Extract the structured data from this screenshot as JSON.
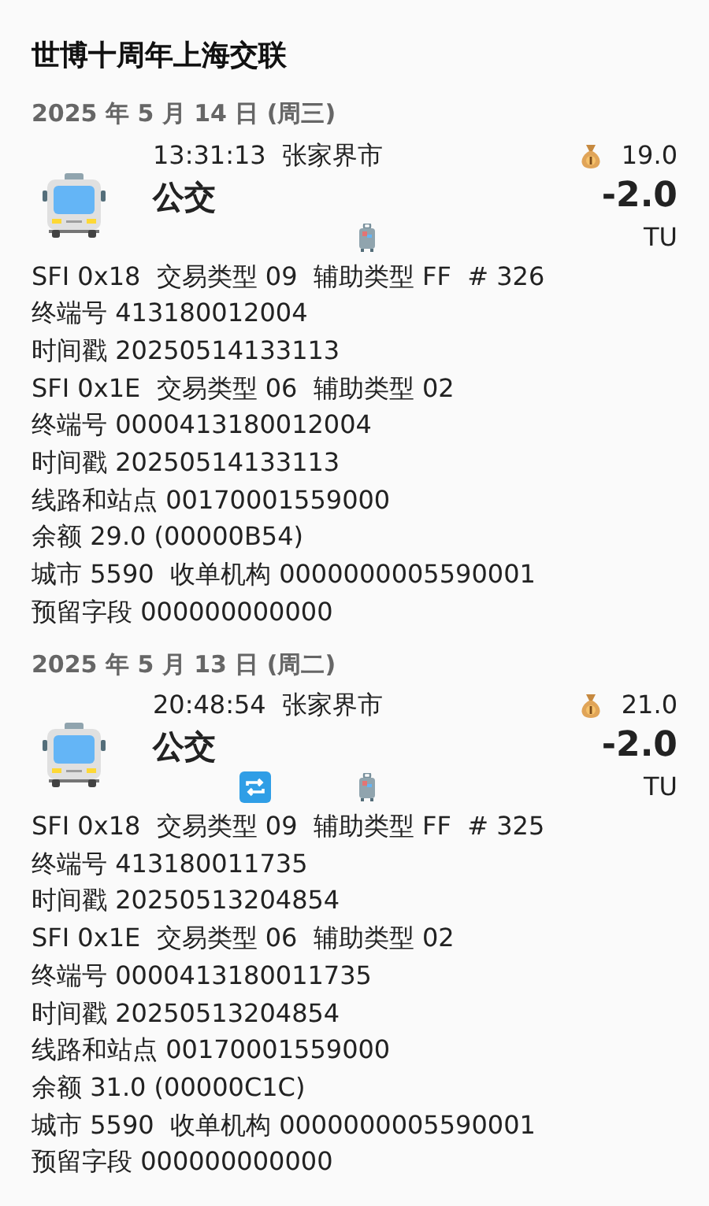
{
  "title": "世博十周年上海交联",
  "days": [
    {
      "date": "2025 年 5 月 14 日 (周三)",
      "records": [
        {
          "time_place": "13:31:13  张家界市",
          "type": "公交",
          "balance": "19.0",
          "amount": "-2.0",
          "unit": "TU",
          "transfer": false,
          "lines": [
            "SFI 0x18  交易类型 09  辅助类型 FF  # 326",
            "终端号 413180012004",
            "时间戳 20250514133113",
            "SFI 0x1E  交易类型 06  辅助类型 02",
            "终端号 0000413180012004",
            "时间戳 20250514133113",
            "线路和站点 00170001559000",
            "余额 29.0 (00000B54)",
            "城市 5590  收单机构 0000000005590001",
            "预留字段 000000000000"
          ]
        }
      ]
    },
    {
      "date": "2025 年 5 月 13 日 (周二)",
      "records": [
        {
          "time_place": "20:48:54  张家界市",
          "type": "公交",
          "balance": "21.0",
          "amount": "-2.0",
          "unit": "TU",
          "transfer": true,
          "lines": [
            "SFI 0x18  交易类型 09  辅助类型 FF  # 325",
            "终端号 413180011735",
            "时间戳 20250513204854",
            "SFI 0x1E  交易类型 06  辅助类型 02",
            "终端号 0000413180011735",
            "时间戳 20250513204854",
            "线路和站点 00170001559000",
            "余额 31.0 (00000C1C)",
            "城市 5590  收单机构 0000000005590001",
            "预留字段 000000000000"
          ]
        }
      ]
    }
  ]
}
